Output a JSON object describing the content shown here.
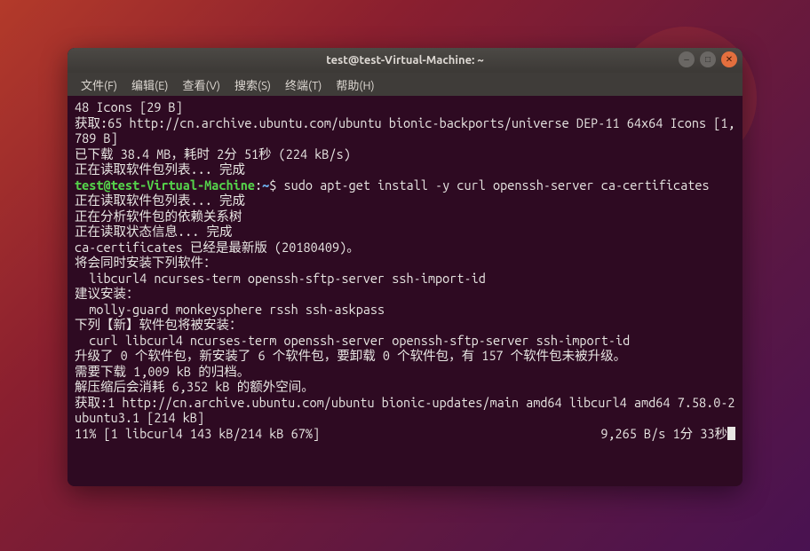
{
  "window": {
    "title": "test@test-Virtual-Machine: ~",
    "controls": {
      "min": "–",
      "max": "□",
      "close": "✕"
    }
  },
  "menu": {
    "file": "文件(F)",
    "edit": "编辑(E)",
    "view": "查看(V)",
    "search": "搜索(S)",
    "terminal": "终端(T)",
    "help": "帮助(H)"
  },
  "prompt": {
    "user_host": "test@test-Virtual-Machine",
    "sep": ":",
    "path": "~",
    "dollar": "$ ",
    "command": "sudo apt-get install -y curl openssh-server ca-certificates"
  },
  "lines": {
    "l01": "48 Icons [29 B]",
    "l02": "获取:65 http://cn.archive.ubuntu.com/ubuntu bionic-backports/universe DEP-11 64x64 Icons [1,789 B]",
    "l03": "已下载 38.4 MB，耗时 2分 51秒 (224 kB/s)",
    "l04": "正在读取软件包列表... 完成",
    "l05": "正在读取软件包列表... 完成",
    "l06": "正在分析软件包的依赖关系树",
    "l07": "正在读取状态信息... 完成",
    "l08": "ca-certificates 已经是最新版 (20180409)。",
    "l09": "将会同时安装下列软件：",
    "l10": "  libcurl4 ncurses-term openssh-sftp-server ssh-import-id",
    "l11": "建议安装：",
    "l12": "  molly-guard monkeysphere rssh ssh-askpass",
    "l13": "下列【新】软件包将被安装：",
    "l14": "  curl libcurl4 ncurses-term openssh-server openssh-sftp-server ssh-import-id",
    "l15": "升级了 0 个软件包，新安装了 6 个软件包，要卸载 0 个软件包，有 157 个软件包未被升级。",
    "l16": "需要下载 1,009 kB 的归档。",
    "l17": "解压缩后会消耗 6,352 kB 的额外空间。",
    "l18": "获取:1 http://cn.archive.ubuntu.com/ubuntu bionic-updates/main amd64 libcurl4 amd64 7.58.0-2ubuntu3.1 [214 kB]",
    "l19_left": "11% [1 libcurl4 143 kB/214 kB 67%]",
    "l19_right": "9,265 B/s 1分 33秒"
  }
}
